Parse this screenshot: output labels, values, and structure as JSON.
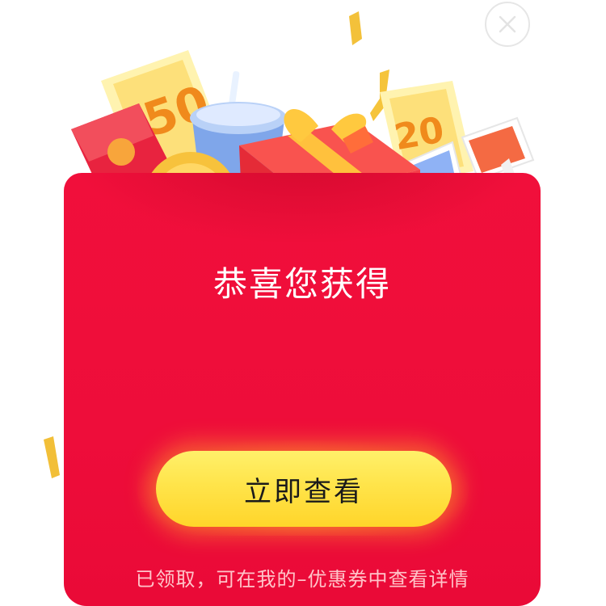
{
  "close_button": {
    "icon": "close-icon"
  },
  "illustration": {
    "ticket_left_value": "50",
    "ticket_right_value": "20",
    "items": [
      "red-packet-icon",
      "coin-icon",
      "drink-cup-icon",
      "gift-box-icon",
      "3d-glasses-icon",
      "ticket-icon",
      "confetti-icon"
    ]
  },
  "envelope": {
    "headline": "恭喜您获得",
    "cta_label": "立即查看",
    "footnote": "已领取，可在我的–优惠券中查看详情"
  },
  "colors": {
    "envelope_red": "#f10f3b",
    "button_yellow": "#ffe44a",
    "gold": "#f5b82a",
    "footnote_pink": "#ffc4c9"
  }
}
